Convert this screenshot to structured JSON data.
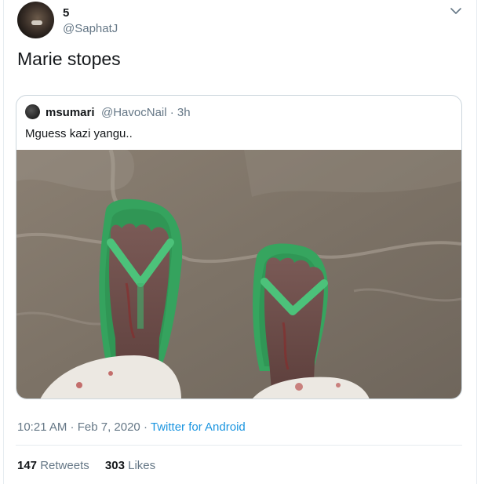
{
  "tweet": {
    "display_name": "5",
    "handle": "@SaphatJ",
    "text": "Marie stopes",
    "timestamp": "10:21 AM · Feb 7, 2020",
    "separator": "·",
    "source": "Twitter for Android"
  },
  "quoted_tweet": {
    "display_name": "msumari",
    "handle": "@HavocNail",
    "time": "· 3h",
    "text": "Mguess kazi yangu.."
  },
  "stats": {
    "retweets_count": "147",
    "retweets_label": "Retweets",
    "likes_count": "303",
    "likes_label": "Likes"
  },
  "icons": {
    "menu": "chevron-down-icon"
  },
  "colors": {
    "link": "#1b95e0",
    "muted": "#657786",
    "text": "#14171a",
    "sandal": "#3fb56a"
  }
}
